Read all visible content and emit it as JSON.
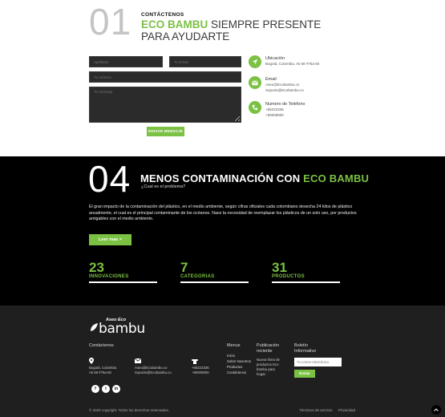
{
  "contact": {
    "number": "01",
    "kicker": "CONTÁCTENOS",
    "title_brand": "ECO BAMBU",
    "title_rest": " SIEMPRE PRESENTE PARA AYUDARTE",
    "form": {
      "name_placeholder": "Apellidos",
      "email_placeholder": "Tu Email",
      "phone_placeholder": "Tu número",
      "message_placeholder": "Tu mensaje",
      "send_label": "ENVIAR MENSAJE"
    },
    "info": {
      "location_label": "Ubicación",
      "location_value": "Bogotá, Colombia. Ak 68 #75a-50",
      "email_label": "Email",
      "email_value_1": "Aseo@Ecobambu.co",
      "email_value_2": "Soporte@Ecobambu.co",
      "phone_label": "Numero de Telefono",
      "phone_value_1": "+65222336",
      "phone_value_2": "+90009000"
    }
  },
  "mission": {
    "number": "04",
    "title_rest": "MENOS CONTAMINACIÓN CON ",
    "title_brand": "ECO BAMBU",
    "subtitle": "¿Cual es el problema?",
    "paragraph": "El gran impacto de la contaminación del plástico, en el medio ambiente, según cifras oficiales cada colombiano desecha 24 kilos de plástico anualmente, el cual es el principal contaminante de los océanos. Nace la necesidad de reemplazar los plásticos de un solo uso, por productos amigables con el medio ambiente.",
    "more_label": "Leer mas >",
    "stats": [
      {
        "value": "23",
        "caption": "INNOVACIONES"
      },
      {
        "value": "7",
        "caption": "CATEGORIAS"
      },
      {
        "value": "31",
        "caption": "PRODUCTOS"
      }
    ]
  },
  "footer": {
    "logo_small": "Aseo Eco",
    "logo_large": "bambu",
    "contact_heading": "Contáctenos",
    "address_1": "Bogotá, Colombia",
    "address_2": "Ak 68 #75a-50",
    "email_1": "Aseo@Ecobambu.co",
    "email_2": "Soporte@Ecobambu.co",
    "phone_1": "+65222336",
    "phone_2": "+90009000",
    "menu_heading": "Menus",
    "menu_items": [
      "Inicio",
      "Sobre Nosotros",
      "Productos",
      "Contáctenos"
    ],
    "pub_heading": "Publicación reciente",
    "pub_text": "Nueva línea de productos Eco bambu para hogar.",
    "news_heading": "Boletín Informativo",
    "news_placeholder": "Tu correo electrónico",
    "news_button": "Enviar",
    "social": [
      "f",
      "t",
      "in"
    ],
    "copyright": "© 2020 copyright. Todos los derechos reservados.",
    "terms": "Términos de servicio",
    "privacy": "Privacidad"
  },
  "colors": {
    "accent": "#7bc143",
    "dark": "#000000",
    "footer_bg": "#1f1f1f"
  }
}
